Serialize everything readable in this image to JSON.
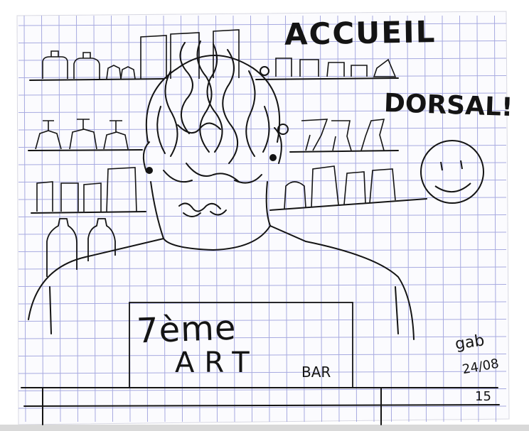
{
  "drawing": {
    "paper_color": "#fbfbfe",
    "grid_color": "#8b8fd6",
    "ink_color": "#141414",
    "title_text": "ACCUEIL",
    "exclaim_text": "DORSAL!",
    "shirt_line1": "7ème",
    "shirt_line2": "ART",
    "bar_word": "BAR",
    "signature_name": "gab",
    "signature_date": "24/08",
    "signature_year": "15"
  }
}
